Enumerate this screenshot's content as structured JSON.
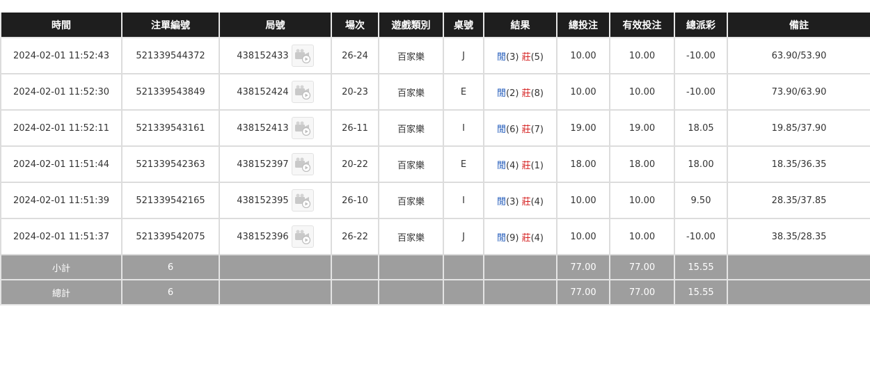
{
  "columns": [
    "時間",
    "注單編號",
    "局號",
    "場次",
    "遊戲類別",
    "桌號",
    "結果",
    "總投注",
    "有效投注",
    "總派彩",
    "備註"
  ],
  "colors": {
    "header_bg": "#1e1e1e",
    "footer_bg": "#9e9e9e",
    "player": "#1a55b8",
    "banker": "#d41c1c",
    "bet_blue": "#1a6bd0",
    "loss_red": "#d90000"
  },
  "icons": {
    "video": "video-camera-play-icon"
  },
  "rows": [
    {
      "time": "2024-02-01 11:52:43",
      "bet_id": "521339544372",
      "round": "438152433",
      "session": "26-24",
      "game": "百家樂",
      "table": "J",
      "player_label": "閒",
      "player_score": "(3)",
      "banker_label": "莊",
      "banker_score": "(5)",
      "total_bet": "10.00",
      "valid_bet": "10.00",
      "payout": "-10.00",
      "payout_negative": true,
      "note": "63.90/53.90"
    },
    {
      "time": "2024-02-01 11:52:30",
      "bet_id": "521339543849",
      "round": "438152424",
      "session": "20-23",
      "game": "百家樂",
      "table": "E",
      "player_label": "閒",
      "player_score": "(2)",
      "banker_label": "莊",
      "banker_score": "(8)",
      "total_bet": "10.00",
      "valid_bet": "10.00",
      "payout": "-10.00",
      "payout_negative": true,
      "note": "73.90/63.90"
    },
    {
      "time": "2024-02-01 11:52:11",
      "bet_id": "521339543161",
      "round": "438152413",
      "session": "26-11",
      "game": "百家樂",
      "table": "I",
      "player_label": "閒",
      "player_score": "(6)",
      "banker_label": "莊",
      "banker_score": "(7)",
      "total_bet": "19.00",
      "valid_bet": "19.00",
      "payout": "18.05",
      "payout_negative": false,
      "note": "19.85/37.90"
    },
    {
      "time": "2024-02-01 11:51:44",
      "bet_id": "521339542363",
      "round": "438152397",
      "session": "20-22",
      "game": "百家樂",
      "table": "E",
      "player_label": "閒",
      "player_score": "(4)",
      "banker_label": "莊",
      "banker_score": "(1)",
      "total_bet": "18.00",
      "valid_bet": "18.00",
      "payout": "18.00",
      "payout_negative": false,
      "note": "18.35/36.35"
    },
    {
      "time": "2024-02-01 11:51:39",
      "bet_id": "521339542165",
      "round": "438152395",
      "session": "26-10",
      "game": "百家樂",
      "table": "I",
      "player_label": "閒",
      "player_score": "(3)",
      "banker_label": "莊",
      "banker_score": "(4)",
      "total_bet": "10.00",
      "valid_bet": "10.00",
      "payout": "9.50",
      "payout_negative": false,
      "note": "28.35/37.85"
    },
    {
      "time": "2024-02-01 11:51:37",
      "bet_id": "521339542075",
      "round": "438152396",
      "session": "26-22",
      "game": "百家樂",
      "table": "J",
      "player_label": "閒",
      "player_score": "(9)",
      "banker_label": "莊",
      "banker_score": "(4)",
      "total_bet": "10.00",
      "valid_bet": "10.00",
      "payout": "-10.00",
      "payout_negative": true,
      "note": "38.35/28.35"
    }
  ],
  "subtotal": {
    "label": "小計",
    "count": "6",
    "total_bet": "77.00",
    "valid_bet": "77.00",
    "payout": "15.55"
  },
  "grand_total": {
    "label": "總計",
    "count": "6",
    "total_bet": "77.00",
    "valid_bet": "77.00",
    "payout": "15.55"
  }
}
